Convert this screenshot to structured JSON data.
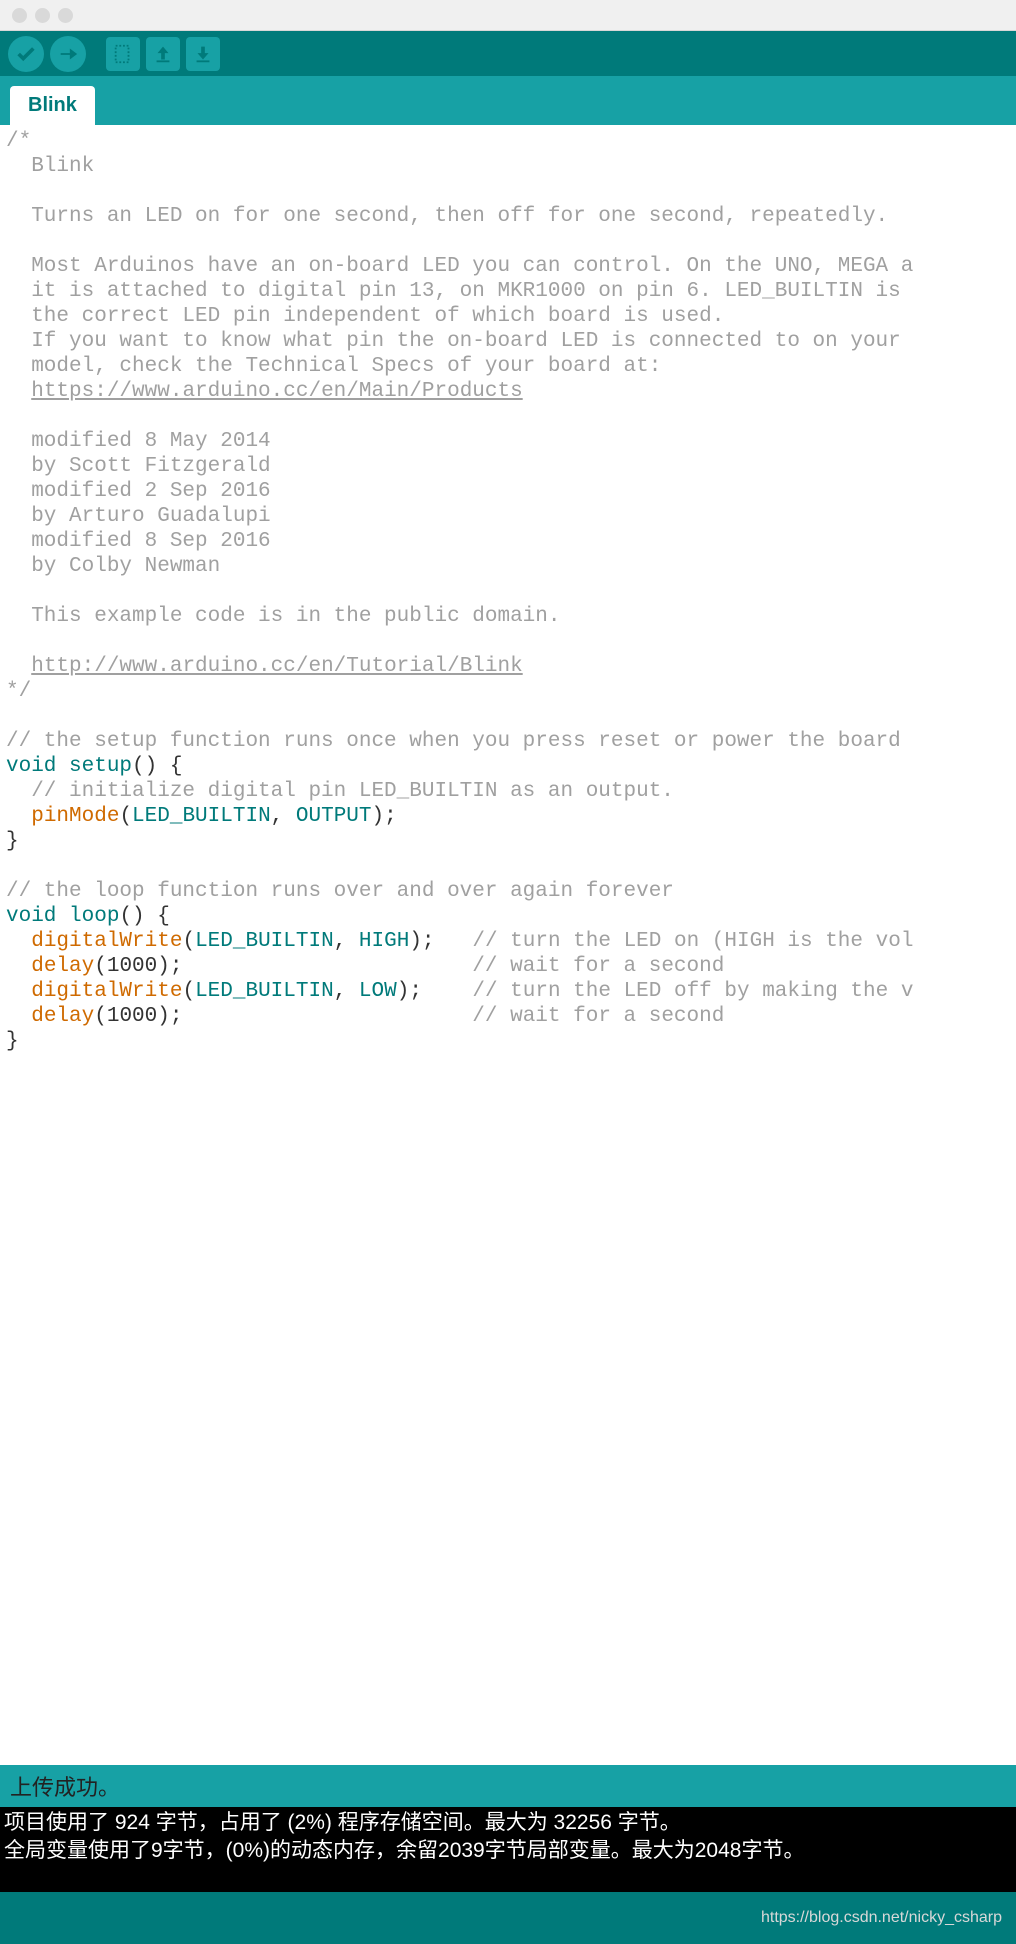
{
  "tab": {
    "label": "Blink"
  },
  "toolbar": {
    "verify": "verify-button",
    "upload": "upload-button",
    "new": "new-sketch-button",
    "open": "open-button",
    "save": "save-button"
  },
  "code": {
    "c_open": "/*",
    "c1": "  Blink",
    "c_blank": "",
    "c2": "  Turns an LED on for one second, then off for one second, repeatedly.",
    "c3": "  Most Arduinos have an on-board LED you can control. On the UNO, MEGA a",
    "c4": "  it is attached to digital pin 13, on MKR1000 on pin 6. LED_BUILTIN is ",
    "c5": "  the correct LED pin independent of which board is used.",
    "c6": "  If you want to know what pin the on-board LED is connected to on your",
    "c7": "  model, check the Technical Specs of your board at:",
    "link1_pad": "  ",
    "link1": "https://www.arduino.cc/en/Main/Products",
    "c8": "  modified 8 May 2014",
    "c9": "  by Scott Fitzgerald",
    "c10": "  modified 2 Sep 2016",
    "c11": "  by Arturo Guadalupi",
    "c12": "  modified 8 Sep 2016",
    "c13": "  by Colby Newman",
    "c14": "  This example code is in the public domain.",
    "link2_pad": "  ",
    "link2": "http://www.arduino.cc/en/Tutorial/Blink",
    "c_close": "*/",
    "c15": "// the setup function runs once when you press reset or power the board",
    "kw_void1": "void",
    "fn_setup": " setup",
    "setup_sig": "() {",
    "c16": "  // initialize digital pin LED_BUILTIN as an output.",
    "pm_indent": "  ",
    "fn_pinmode": "pinMode",
    "pm_open": "(",
    "const_ledb": "LED_BUILTIN",
    "pm_comma": ", ",
    "const_output": "OUTPUT",
    "pm_end": ");",
    "brace_close1": "}",
    "c17": "// the loop function runs over and over again forever",
    "kw_void2": "void",
    "fn_loop": " loop",
    "loop_sig": "() {",
    "dw_indent": "  ",
    "fn_dw1": "digitalWrite",
    "dw1_open": "(",
    "dw1_comma": ", ",
    "const_high": "HIGH",
    "dw1_end": ");   ",
    "c18": "// turn the LED on (HIGH is the vol",
    "fn_delay1": "delay",
    "delay1_arg": "(1000);                       ",
    "c19": "// wait for a second",
    "fn_dw2": "digitalWrite",
    "dw2_open": "(",
    "dw2_comma": ", ",
    "const_low": "LOW",
    "dw2_end": ");    ",
    "c20": "// turn the LED off by making the v",
    "fn_delay2": "delay",
    "delay2_arg": "(1000);                       ",
    "c21": "// wait for a second",
    "brace_close2": "}"
  },
  "status": {
    "message": "上传成功。"
  },
  "console": {
    "line1": "项目使用了 924 字节，占用了 (2%) 程序存储空间。最大为 32256 字节。",
    "line2": "全局变量使用了9字节，(0%)的动态内存，余留2039字节局部变量。最大为2048字节。"
  },
  "watermark": {
    "text": "https://blog.csdn.net/nicky_csharp"
  }
}
